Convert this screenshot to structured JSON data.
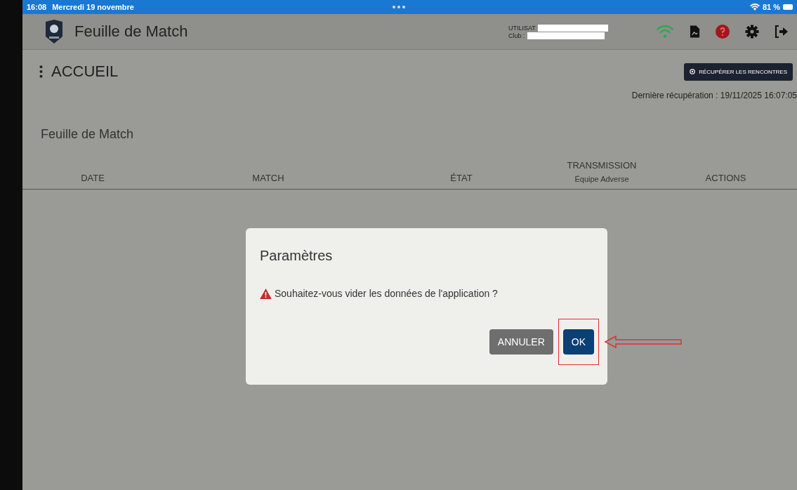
{
  "status_bar": {
    "time": "16:08",
    "date": "Mercredi 19 novembre",
    "battery": "81 %"
  },
  "header": {
    "title": "Feuille de Match",
    "user_label": "UTILISAT",
    "club_label": "Club :"
  },
  "page": {
    "title": "ACCUEIL",
    "fetch_button": "RÉCUPÉRER LES RENCONTRES",
    "last_fetch": "Dernière récupération : 19/11/2025 16:07:05",
    "section_title": "Feuille de Match"
  },
  "table": {
    "columns": [
      {
        "label": "DATE"
      },
      {
        "label": "MATCH"
      },
      {
        "label": "ÉTAT"
      },
      {
        "label": "TRANSMISSION",
        "sublabel": "Équipe Adverse"
      },
      {
        "label": "ACTIONS"
      }
    ]
  },
  "dialog": {
    "title": "Paramètres",
    "message": "Souhaitez-vous vider les données de l'application ?",
    "buttons": [
      {
        "label": "ANNULER",
        "kind": "secondary",
        "highlighted": false
      },
      {
        "label": "OK",
        "kind": "primary",
        "highlighted": true
      }
    ]
  }
}
